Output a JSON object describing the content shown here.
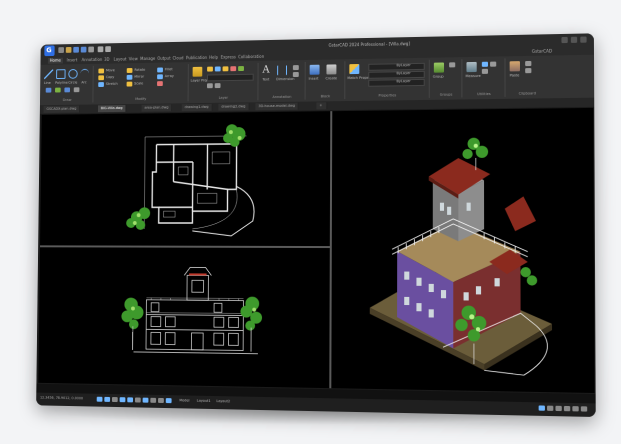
{
  "app": {
    "logo_letter": "G",
    "window_title": "GstarCAD 2024 Professional - [Villa.dwg]",
    "user": "GstarCAD",
    "quick_access": [
      "new-icon",
      "open-icon",
      "save-icon",
      "save-as-icon",
      "print-icon",
      "undo-icon",
      "redo-icon"
    ]
  },
  "menu_tabs": [
    "Home",
    "Insert",
    "Annotation",
    "3D",
    "Layout",
    "View",
    "Manage",
    "Output",
    "Cloud",
    "Publication",
    "Help",
    "Express",
    "Collaboration"
  ],
  "active_tab": "Home",
  "ribbon_groups": [
    {
      "name": "Draw",
      "items": [
        "Line",
        "Polyline",
        "Circle",
        "Arc"
      ]
    },
    {
      "name": "Modify",
      "items": [
        "Move",
        "Copy",
        "Stretch",
        "Rotate",
        "Mirror",
        "Scale",
        "Fillet",
        "Array"
      ]
    },
    {
      "name": "Layer",
      "items": [
        "Layer Properties"
      ]
    },
    {
      "name": "Annotation",
      "items": [
        "Text",
        "Dimension"
      ]
    },
    {
      "name": "Block",
      "items": [
        "Insert",
        "Create"
      ]
    },
    {
      "name": "Properties",
      "items": [
        "Match Properties",
        "ByLayer",
        "ByLayer",
        "ByLayer"
      ]
    },
    {
      "name": "Groups",
      "items": [
        "Group"
      ]
    },
    {
      "name": "Utilities",
      "items": [
        "Measure"
      ]
    },
    {
      "name": "Clipboard",
      "items": [
        "Paste"
      ]
    }
  ],
  "doc_tabs": [
    "GSCADX-plan.dwg",
    "BIG-Villa.dwg",
    "area-plan.dwg",
    "drawing1.dwg",
    "drawing2.dwg",
    "3D-house-model.dwg"
  ],
  "active_doc": "BIG-Villa.dwg",
  "status": {
    "coordinates": "12.3456, 78.9012, 0.0000",
    "layout_tabs": [
      "Model",
      "Layout1",
      "Layout2"
    ]
  },
  "colors": {
    "accent": "#2f6fe4",
    "background": "#000000",
    "chrome": "#2b2b2b"
  }
}
